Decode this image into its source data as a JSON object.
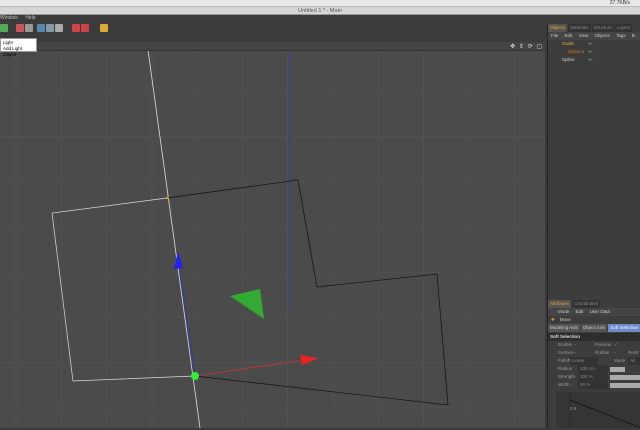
{
  "menubar": {
    "status": "27.7KB/s"
  },
  "window": {
    "title": "Untitled 1 * - Main"
  },
  "app_menu": [
    "Window",
    "Help"
  ],
  "tooltip": {
    "title": "Light",
    "description": "Add Light Object"
  },
  "viewport": {
    "header_icons": [
      "move-view-icon",
      "zoom-view-icon",
      "rotate-view-icon",
      "maximize-view-icon"
    ]
  },
  "object_manager": {
    "tabs": [
      "Objects",
      "Materials",
      "Structure",
      "Layers"
    ],
    "menu": [
      "File",
      "Edit",
      "View",
      "Objects",
      "Tags",
      "B"
    ],
    "objects": [
      {
        "name": "Guide",
        "color": "#f0b030"
      },
      {
        "name": "Spline.1",
        "color": "#e07020"
      },
      {
        "name": "Spline",
        "color": "#cccccc"
      }
    ]
  },
  "attributes": {
    "tabs": [
      "Attributes",
      "Coordinates"
    ],
    "menu": [
      "Mode",
      "Edit",
      "User Data"
    ],
    "tool": "Move",
    "subtabs": [
      "Modeling Axis",
      "Object Axis",
      "Soft Selection"
    ],
    "section": "Soft Selection",
    "enable_label": "Enable",
    "preview_label": "Preview",
    "surface_label": "Surface",
    "rubber_label": "Rubber",
    "restrict_label": "Restr",
    "falloff_label": "Falloff",
    "falloff_value": "Linear",
    "mode_label": "Mode",
    "mode_value": "All",
    "radius_label": "Radius",
    "radius_value": "100 cm",
    "strength_label": "Strength",
    "strength_value": "100 %",
    "width_label": "Width . .",
    "width_value": "50 %",
    "graph_label": "0.8"
  }
}
